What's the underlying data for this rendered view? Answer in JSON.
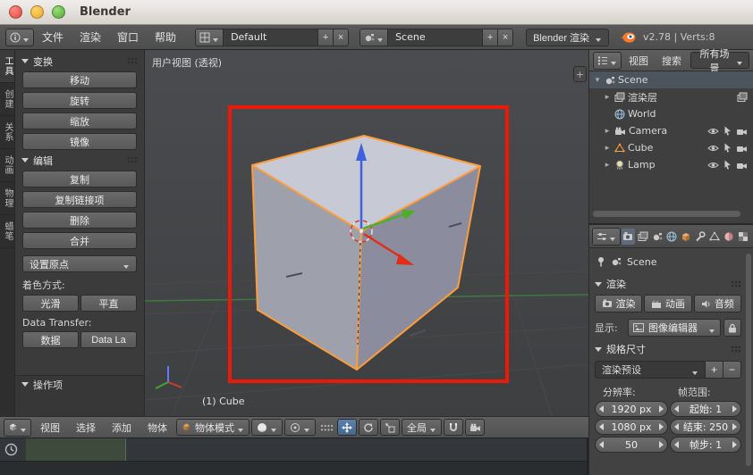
{
  "titlebar": {
    "title": "Blender"
  },
  "menubar": {
    "file": "文件",
    "render": "渲染",
    "window": "窗口",
    "help": "帮助",
    "layout_value": "Default",
    "scene_value": "Scene",
    "add_label": "+",
    "close_label": "×",
    "engine_value": "Blender 渲染",
    "stats": "v2.78 | Verts:8"
  },
  "toolshelf": {
    "tabs": [
      "工具",
      "创建",
      "关系",
      "动画",
      "物理",
      "蜡笔"
    ],
    "transform_title": "变换",
    "move": "移动",
    "rotate": "旋转",
    "scale": "缩放",
    "mirror": "镜像",
    "edit_title": "编辑",
    "duplicate": "复制",
    "duplicate_linked": "复制链接项",
    "delete": "删除",
    "join": "合并",
    "set_origin": "设置原点",
    "shading_label": "着色方式:",
    "smooth": "光滑",
    "flat": "平直",
    "data_transfer_label": "Data Transfer:",
    "data": "数据",
    "data_layout": "Data La",
    "operator_title": "操作项"
  },
  "viewport": {
    "view_label": "用户视图 (透视)",
    "object_info": "(1) Cube",
    "region_toggle": "+"
  },
  "vheader": {
    "view": "视图",
    "select": "选择",
    "add": "添加",
    "object": "物体",
    "mode_value": "物体模式",
    "orientation_value": "全局"
  },
  "outliner": {
    "view": "视图",
    "search": "搜索",
    "display_value": "所有场景",
    "rows": [
      {
        "expander": "▾",
        "label": "Scene"
      },
      {
        "expander": "▸",
        "label": "渲染层"
      },
      {
        "expander": "",
        "label": "World"
      },
      {
        "expander": "▸",
        "label": "Camera"
      },
      {
        "expander": "▸",
        "label": "Cube"
      },
      {
        "expander": "▸",
        "label": "Lamp"
      }
    ]
  },
  "properties": {
    "context_value": "Scene",
    "render_title": "渲染",
    "render_btn": "渲染",
    "animation_btn": "动画",
    "audio_btn": "音频",
    "display_label": "显示:",
    "display_value": "图像编辑器",
    "dimensions_title": "规格尺寸",
    "preset_value": "渲染预设",
    "preset_add": "+",
    "preset_remove": "−",
    "resolution_label": "分辨率:",
    "frame_range_label": "帧范围:",
    "res_x": "1920 px",
    "res_y": "1080 px",
    "res_pct": "50",
    "frame_start": "起始: 1",
    "frame_end": "结束: 250",
    "frame_step": "帧步: 1"
  }
}
